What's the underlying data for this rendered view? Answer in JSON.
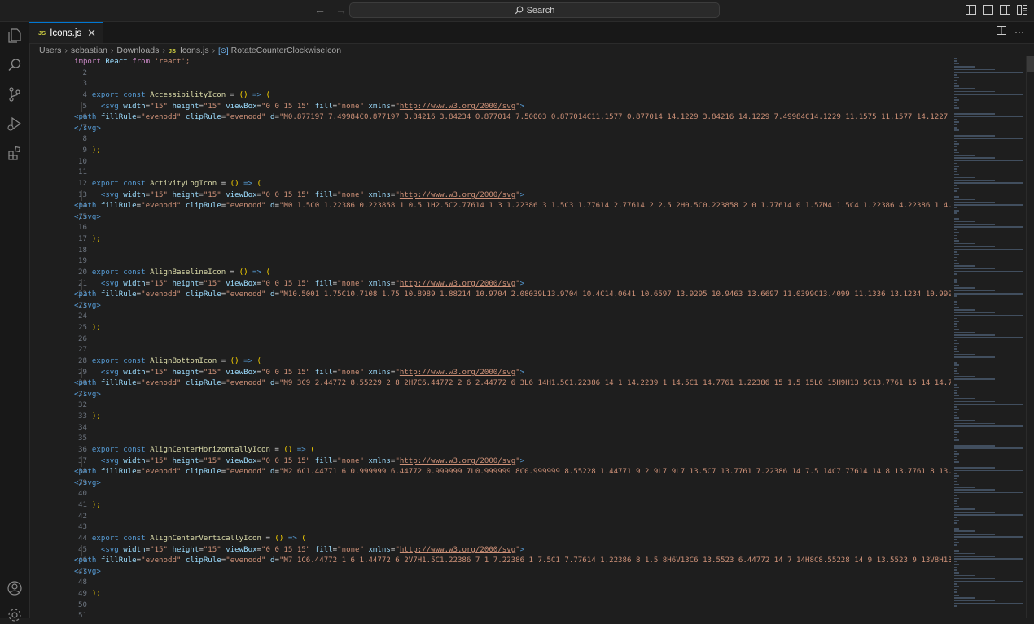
{
  "titlebar": {
    "back_icon": "arrow-left-icon",
    "forward_icon": "arrow-right-icon",
    "search_label": "Search"
  },
  "activity_bar": {
    "items": [
      "explorer-icon",
      "search-icon",
      "source-control-icon",
      "run-debug-icon",
      "extensions-icon"
    ],
    "bottom": [
      "account-icon",
      "settings-gear-icon"
    ]
  },
  "tab": {
    "badge": "JS",
    "label": "Icons.js",
    "close": "✕"
  },
  "tab_actions": {
    "split_icon": "split-editor-icon",
    "more": "···"
  },
  "breadcrumb": {
    "items": [
      "Users",
      "sebastian",
      "Downloads"
    ],
    "file_badge": "JS",
    "file": "Icons.js",
    "symbol_badge": "[⊙]",
    "symbol": "RotateCounterClockwiseIcon"
  },
  "editor": {
    "line_numbers": [
      "1",
      "2",
      "3",
      "4",
      "5",
      "6",
      "7",
      "8",
      "9",
      "10",
      "11",
      "12",
      "13",
      "14",
      "15",
      "16",
      "17",
      "18",
      "19",
      "20",
      "21",
      "22",
      "23",
      "24",
      "25",
      "26",
      "27",
      "28",
      "29",
      "30",
      "31",
      "32",
      "33",
      "34",
      "35",
      "36",
      "37",
      "38",
      "39",
      "40",
      "41",
      "42",
      "43",
      "44",
      "45",
      "46",
      "47",
      "48",
      "49",
      "50",
      "51"
    ],
    "import_react": "React",
    "import_from": "from",
    "import_str": "'react';",
    "svg_attrs": {
      "width": "\"15\"",
      "height": "\"15\"",
      "viewbox": "\"0 0 15 15\"",
      "fill": "\"none\"",
      "xmlns_url": "http://www.w3.org/2000/svg"
    },
    "fill_rule": "\"evenodd\"",
    "svg_close": "</svg>",
    "close_paren": ");",
    "blocks": [
      {
        "name": "AccessibilityIcon",
        "d": "\"M0.877197 7.49984C0.877197 3.84216 3.84234 0.877014 7.50003 0.877014C11.1577 0.877014 14.1229 3.84216 14.1229 7.49984C14.1229 11.1575 11.1577 14.1227"
      },
      {
        "name": "ActivityLogIcon",
        "d": "\"M0 1.5C0 1.22386 0.223858 1 0.5 1H2.5C2.77614 1 3 1.22386 3 1.5C3 1.77614 2.77614 2 2.5 2H0.5C0.223858 2 0 1.77614 0 1.5ZM4 1.5C4 1.22386 4.22386 1 4."
      },
      {
        "name": "AlignBaselineIcon",
        "d": "\"M10.5001 1.75C10.7108 1.75 10.8989 1.88214 10.9704 2.08039L13.9704 10.4C14.0641 10.6597 13.9295 10.9463 13.6697 11.0399C13.4099 11.1336 13.1234 10.999"
      },
      {
        "name": "AlignBottomIcon",
        "d": "\"M9 3C9 2.44772 8.55229 2 8 2H7C6.44772 2 6 2.44772 6 3L6 14H1.5C1.22386 14 1 14.2239 1 14.5C1 14.7761 1.22386 15 1.5 15L6 15H9H13.5C13.7761 15 14 14.7"
      },
      {
        "name": "AlignCenterHorizontallyIcon",
        "d": "\"M2 6C1.44771 6 0.999999 6.44772 0.999999 7L0.999999 8C0.999999 8.55228 1.44771 9 2 9L7 9L7 13.5C7 13.7761 7.22386 14 7.5 14C7.77614 14 8 13.7761 8 13.5"
      },
      {
        "name": "AlignCenterVerticallyIcon",
        "d": "\"M7 1C6.44772 1 6 1.44772 6 2V7H1.5C1.22386 7 1 7.22386 1 7.5C1 7.77614 1.22386 8 1.5 8H6V13C6 13.5523 6.44772 14 7 14H8C8.55228 14 9 13.5523 9 13V8H13."
      }
    ]
  },
  "colors": {
    "accent": "#0078d4",
    "editor_bg": "#1e1e1e",
    "keyword": "#569cd6",
    "string": "#ce9178",
    "function": "#dcdcaa"
  }
}
